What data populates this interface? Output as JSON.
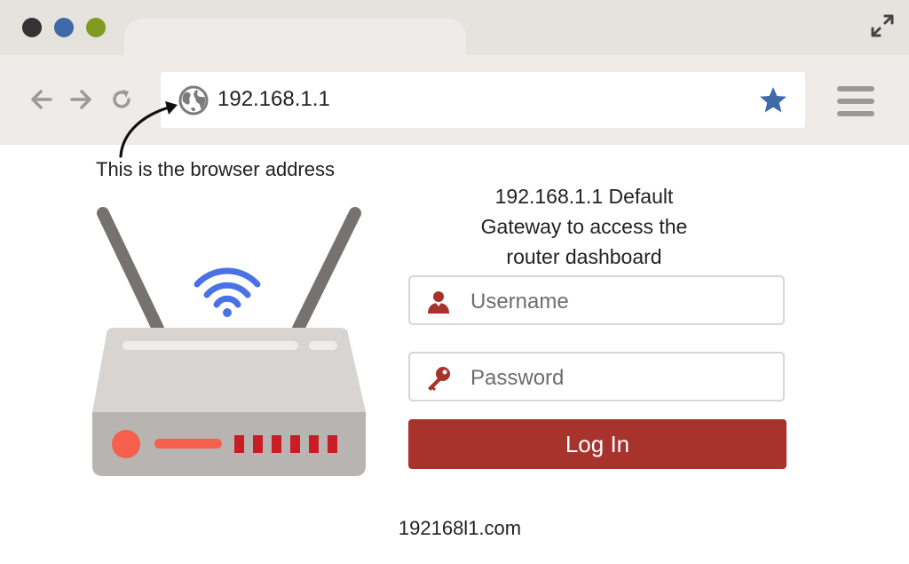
{
  "window": {
    "controls": [
      {
        "name": "close",
        "color": "#333333"
      },
      {
        "name": "minimize",
        "color": "#3e6aa7"
      },
      {
        "name": "maximize",
        "color": "#7f9c20"
      }
    ]
  },
  "toolbar": {
    "back_icon": "arrow-left-icon",
    "forward_icon": "arrow-right-icon",
    "reload_icon": "reload-icon",
    "menu_icon": "hamburger-menu-icon"
  },
  "address_bar": {
    "url": "192.168.1.1",
    "icon": "globe-icon",
    "bookmark_icon": "star-icon",
    "bookmark_color": "#3e6aa7"
  },
  "annotation": {
    "caption": "This is the browser address"
  },
  "login": {
    "heading_lines": [
      "192.168.1.1 Default",
      "Gateway to access the",
      "router dashboard"
    ],
    "username_placeholder": "Username",
    "password_placeholder": "Password",
    "login_label": "Log In",
    "accent_color": "#a8332c"
  },
  "router": {
    "wifi_color": "#4a72e6",
    "led_color": "#f4604c",
    "port_color": "#c81d25",
    "port_count": 6
  },
  "footer": {
    "text": "192168l1.com"
  }
}
